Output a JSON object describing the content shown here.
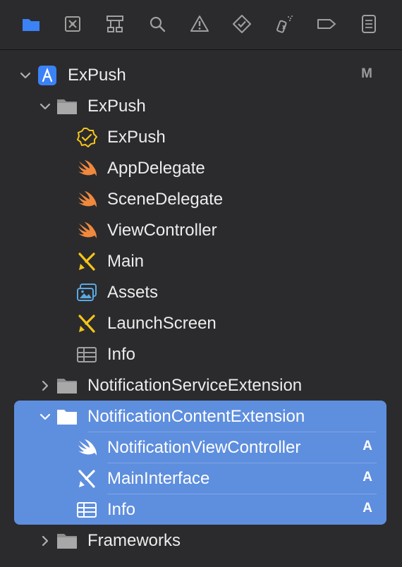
{
  "toolbar": {
    "icons": [
      "folder-icon",
      "source-control-icon",
      "symbol-hierarchy-icon",
      "search-icon",
      "warning-icon",
      "test-diamond-icon",
      "debug-spray-icon",
      "breakpoint-tag-icon",
      "report-list-icon"
    ],
    "accent": "#3b82f6"
  },
  "tree": {
    "project": {
      "label": "ExPush",
      "badge": "M"
    },
    "group_expush": {
      "label": "ExPush"
    },
    "expush_entitlement": {
      "label": "ExPush"
    },
    "app_delegate": {
      "label": "AppDelegate"
    },
    "scene_delegate": {
      "label": "SceneDelegate"
    },
    "view_controller": {
      "label": "ViewController"
    },
    "main": {
      "label": "Main"
    },
    "assets": {
      "label": "Assets"
    },
    "launch_screen": {
      "label": "LaunchScreen"
    },
    "info": {
      "label": "Info"
    },
    "group_service_ext": {
      "label": "NotificationServiceExtension"
    },
    "group_content_ext": {
      "label": "NotificationContentExtension"
    },
    "notification_view_controller": {
      "label": "NotificationViewController",
      "badge": "A"
    },
    "main_interface": {
      "label": "MainInterface",
      "badge": "A"
    },
    "content_info": {
      "label": "Info",
      "badge": "A"
    },
    "frameworks": {
      "label": "Frameworks"
    }
  },
  "colors": {
    "background": "#2b2b2d",
    "selection": "#5e8ede",
    "swift": "#f0883e",
    "storyboard": "#f5c518",
    "assets": "#5aa9e6",
    "folder": "#9a9a9a"
  }
}
